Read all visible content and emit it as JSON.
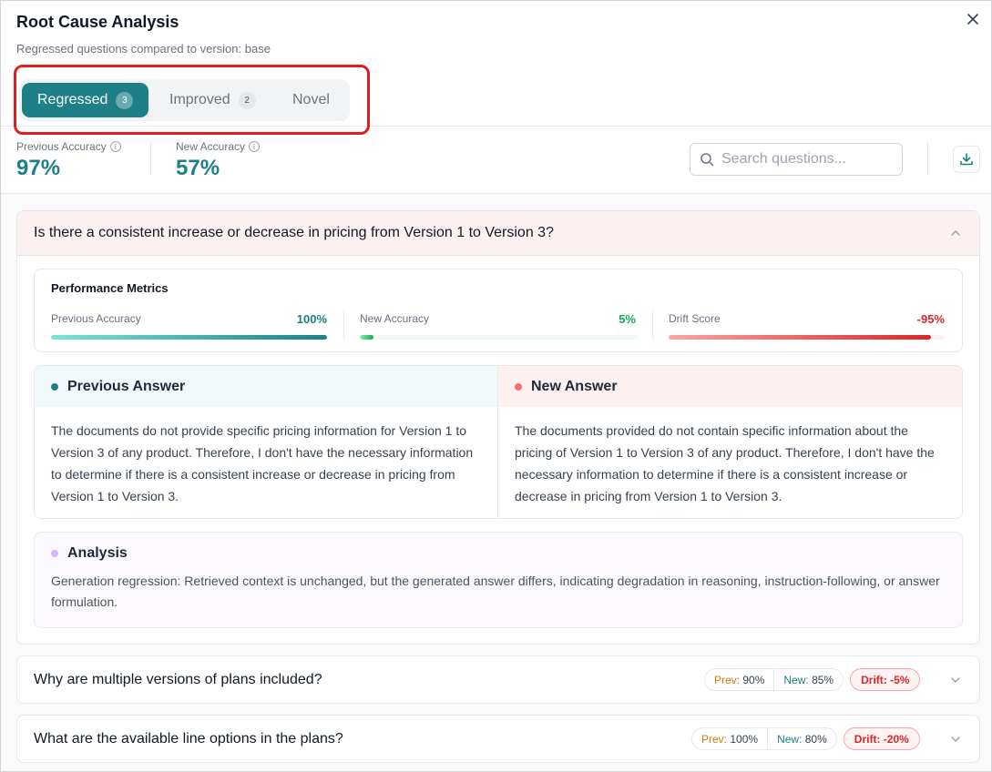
{
  "header": {
    "title": "Root Cause Analysis",
    "subtitle": "Regressed questions compared to version: base"
  },
  "tabs": [
    {
      "label": "Regressed",
      "count": "3",
      "active": true
    },
    {
      "label": "Improved",
      "count": "2",
      "active": false
    },
    {
      "label": "Novel",
      "count": null,
      "active": false
    }
  ],
  "stats": {
    "previous_label": "Previous Accuracy",
    "previous_value": "97%",
    "new_label": "New Accuracy",
    "new_value": "57%"
  },
  "search": {
    "placeholder": "Search questions..."
  },
  "questions": [
    {
      "text": "Is there a consistent increase or decrease in pricing from Version 1 to Version 3?",
      "expanded": true,
      "metrics_title": "Performance Metrics",
      "metrics": [
        {
          "label": "Previous Accuracy",
          "value": "100%",
          "fraction": 1.0,
          "color": "#1e7f86"
        },
        {
          "label": "New Accuracy",
          "value": "5%",
          "fraction": 0.05,
          "color": "#16a34a"
        },
        {
          "label": "Drift Score",
          "value": "-95%",
          "fraction": 0.95,
          "color": "#dc2626"
        }
      ],
      "previous_answer_title": "Previous Answer",
      "previous_answer": "The documents do not provide specific pricing information for Version 1 to Version 3 of any product. Therefore, I don't have the necessary information to determine if there is a consistent increase or decrease in pricing from Version 1 to Version 3.",
      "new_answer_title": "New Answer",
      "new_answer": "The documents provided do not contain specific information about the pricing of Version 1 to Version 3 of any product. Therefore, I don't have the necessary information to determine if there is a consistent increase or decrease in pricing from Version 1 to Version 3.",
      "analysis_title": "Analysis",
      "analysis": "Generation regression: Retrieved context is unchanged, but the generated answer differs, indicating degradation in reasoning, instruction-following, or answer formulation."
    },
    {
      "text": "Why are multiple versions of plans included?",
      "expanded": false,
      "prev_label": "Prev:",
      "prev_value": "90%",
      "new_label": "New:",
      "new_value": "85%",
      "drift_label": "Drift:",
      "drift_value": "-5%"
    },
    {
      "text": "What are the available line options in the plans?",
      "expanded": false,
      "prev_label": "Prev:",
      "prev_value": "100%",
      "new_label": "New:",
      "new_value": "80%",
      "drift_label": "Drift:",
      "drift_value": "-20%"
    }
  ],
  "colors": {
    "accent": "#1e7f86",
    "regression_bg": "#fdf0f0",
    "highlight_border": "#e11d1d"
  }
}
